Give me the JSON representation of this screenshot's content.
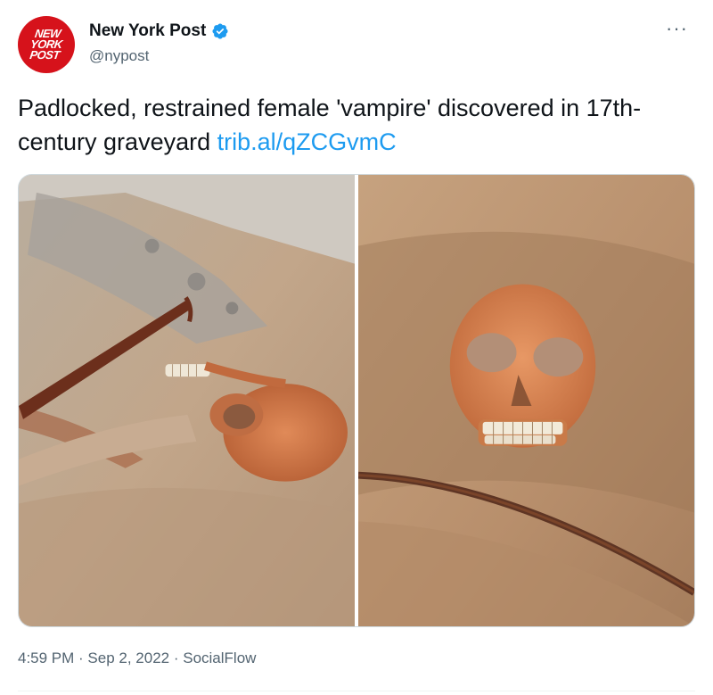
{
  "author": {
    "name": "New York Post",
    "handle": "@nypost",
    "verified": true,
    "avatar_text": [
      "NEW",
      "YORK",
      "POST"
    ]
  },
  "more_label": "···",
  "tweet": {
    "text": "Padlocked, restrained female 'vampire' discovered in 17th-century graveyard",
    "link": "trib.al/qZCGvmC"
  },
  "media": [
    {
      "icon": "photo-skeleton-sickle-side"
    },
    {
      "icon": "photo-skull-front"
    }
  ],
  "meta": {
    "time": "4:59 PM",
    "date": "Sep 2, 2022",
    "source": "SocialFlow",
    "separator": " · "
  },
  "colors": {
    "brand_red": "#d6121b",
    "link_blue": "#1d9bf0",
    "verified_blue": "#1d9bf0",
    "secondary_text": "#536471"
  }
}
